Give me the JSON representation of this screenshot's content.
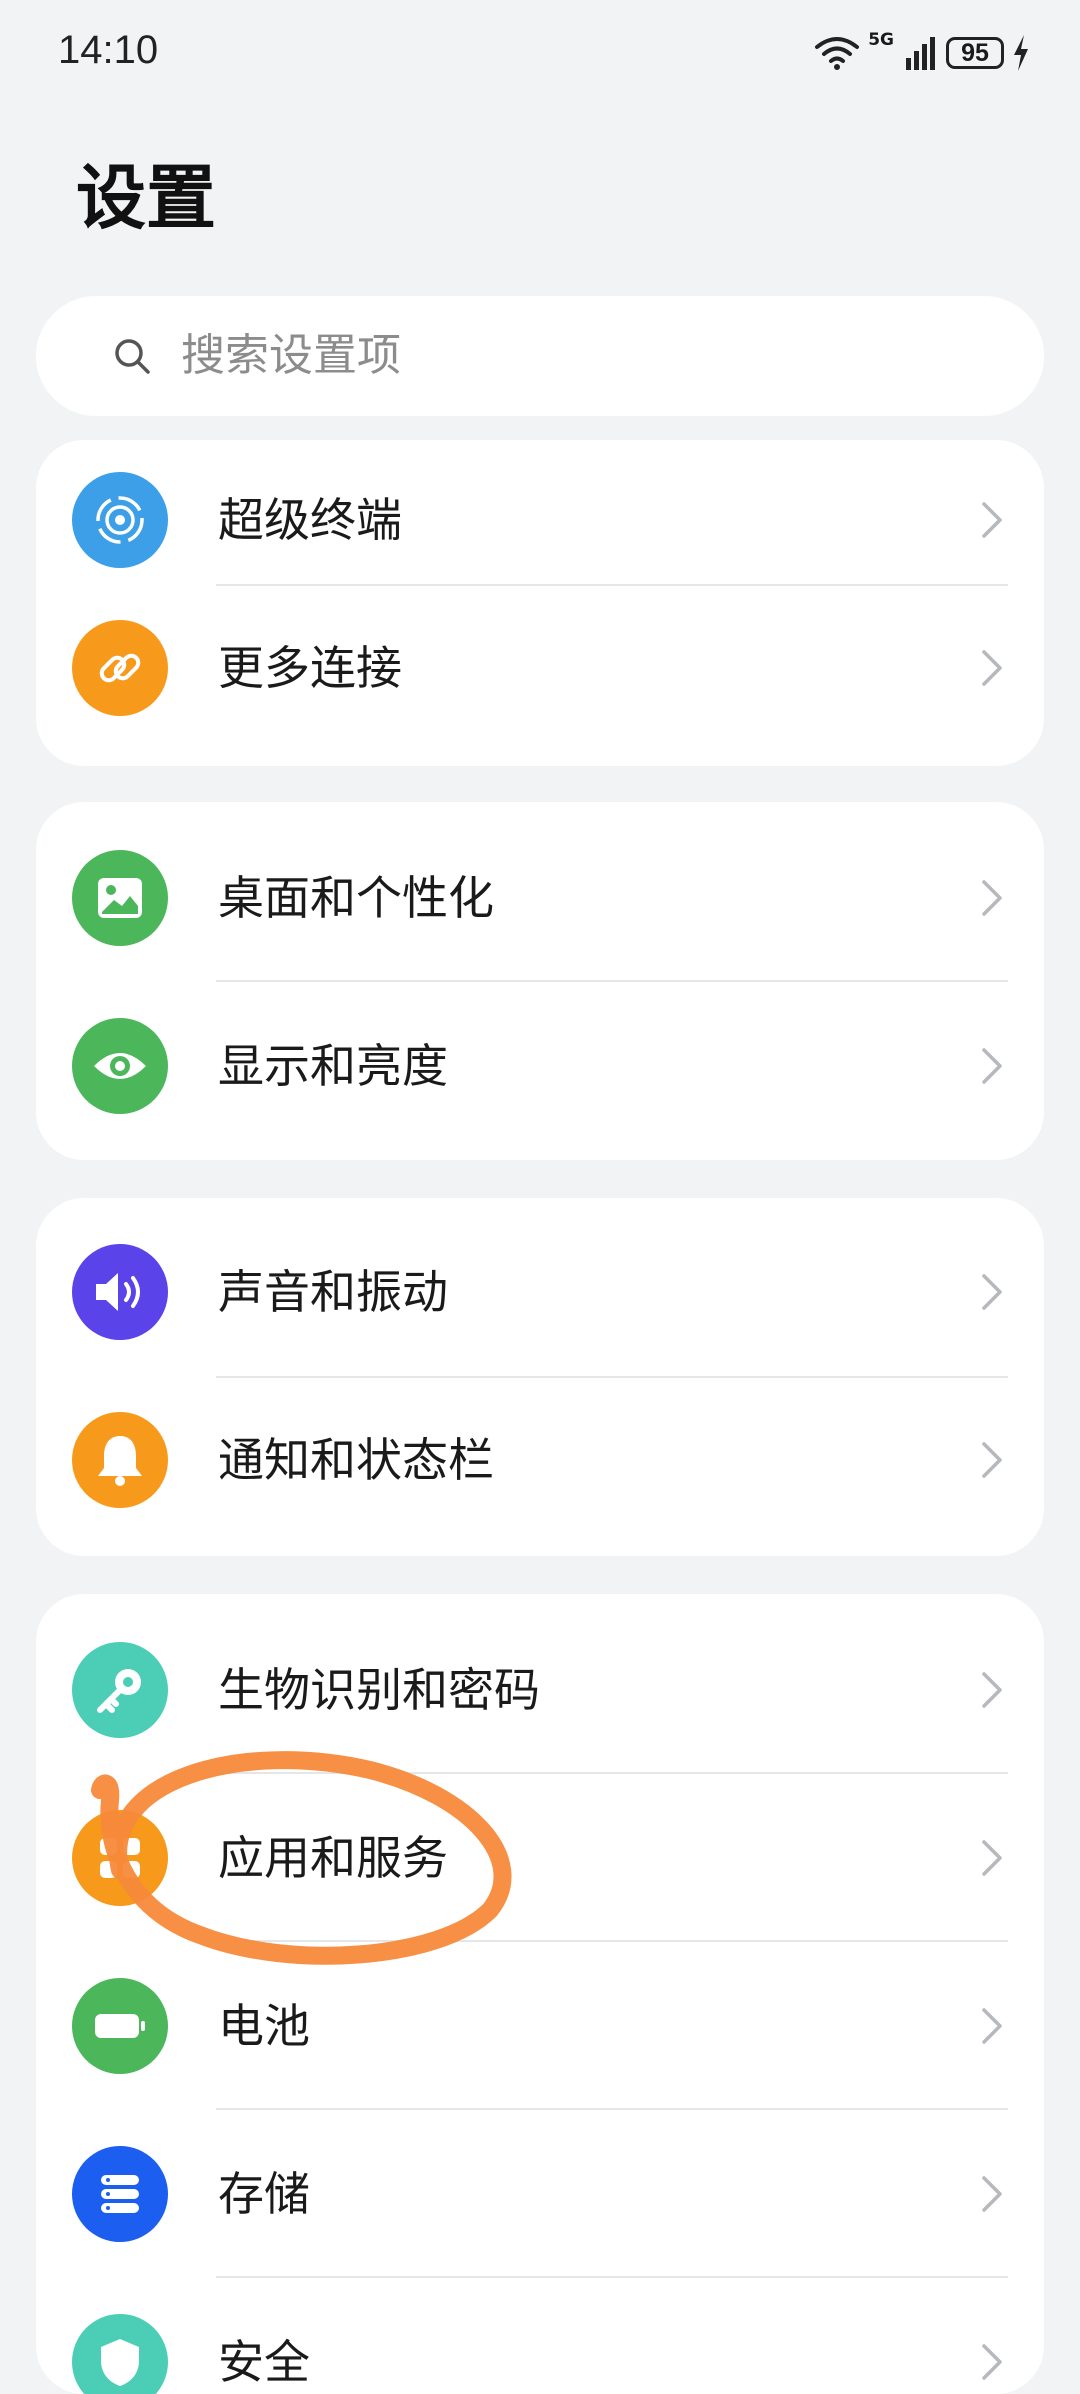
{
  "status_bar": {
    "time": "14:10",
    "network": "5G",
    "battery": "95"
  },
  "page_title": "设置",
  "search": {
    "placeholder": "搜索设置项"
  },
  "groups": [
    {
      "items": [
        {
          "label": "超级终端",
          "icon": "super-device-icon",
          "color": "#3d9fe8"
        },
        {
          "label": "更多连接",
          "icon": "link-icon",
          "color": "#f79a1c"
        }
      ]
    },
    {
      "items": [
        {
          "label": "桌面和个性化",
          "icon": "picture-icon",
          "color": "#4cb75a"
        },
        {
          "label": "显示和亮度",
          "icon": "eye-icon",
          "color": "#4cb75a"
        }
      ]
    },
    {
      "items": [
        {
          "label": "声音和振动",
          "icon": "speaker-icon",
          "color": "#5a43e8"
        },
        {
          "label": "通知和状态栏",
          "icon": "bell-icon",
          "color": "#f79a1c"
        }
      ]
    },
    {
      "items": [
        {
          "label": "生物识别和密码",
          "icon": "key-icon",
          "color": "#4ccdb6"
        },
        {
          "label": "应用和服务",
          "icon": "apps-icon",
          "color": "#f79a1c"
        },
        {
          "label": "电池",
          "icon": "battery-icon",
          "color": "#4cb75a"
        },
        {
          "label": "存储",
          "icon": "storage-icon",
          "color": "#1c5ef0"
        },
        {
          "label": "安全",
          "icon": "shield-icon",
          "color": "#4ccdb6"
        }
      ]
    }
  ],
  "annotation_color": "#f7893a"
}
